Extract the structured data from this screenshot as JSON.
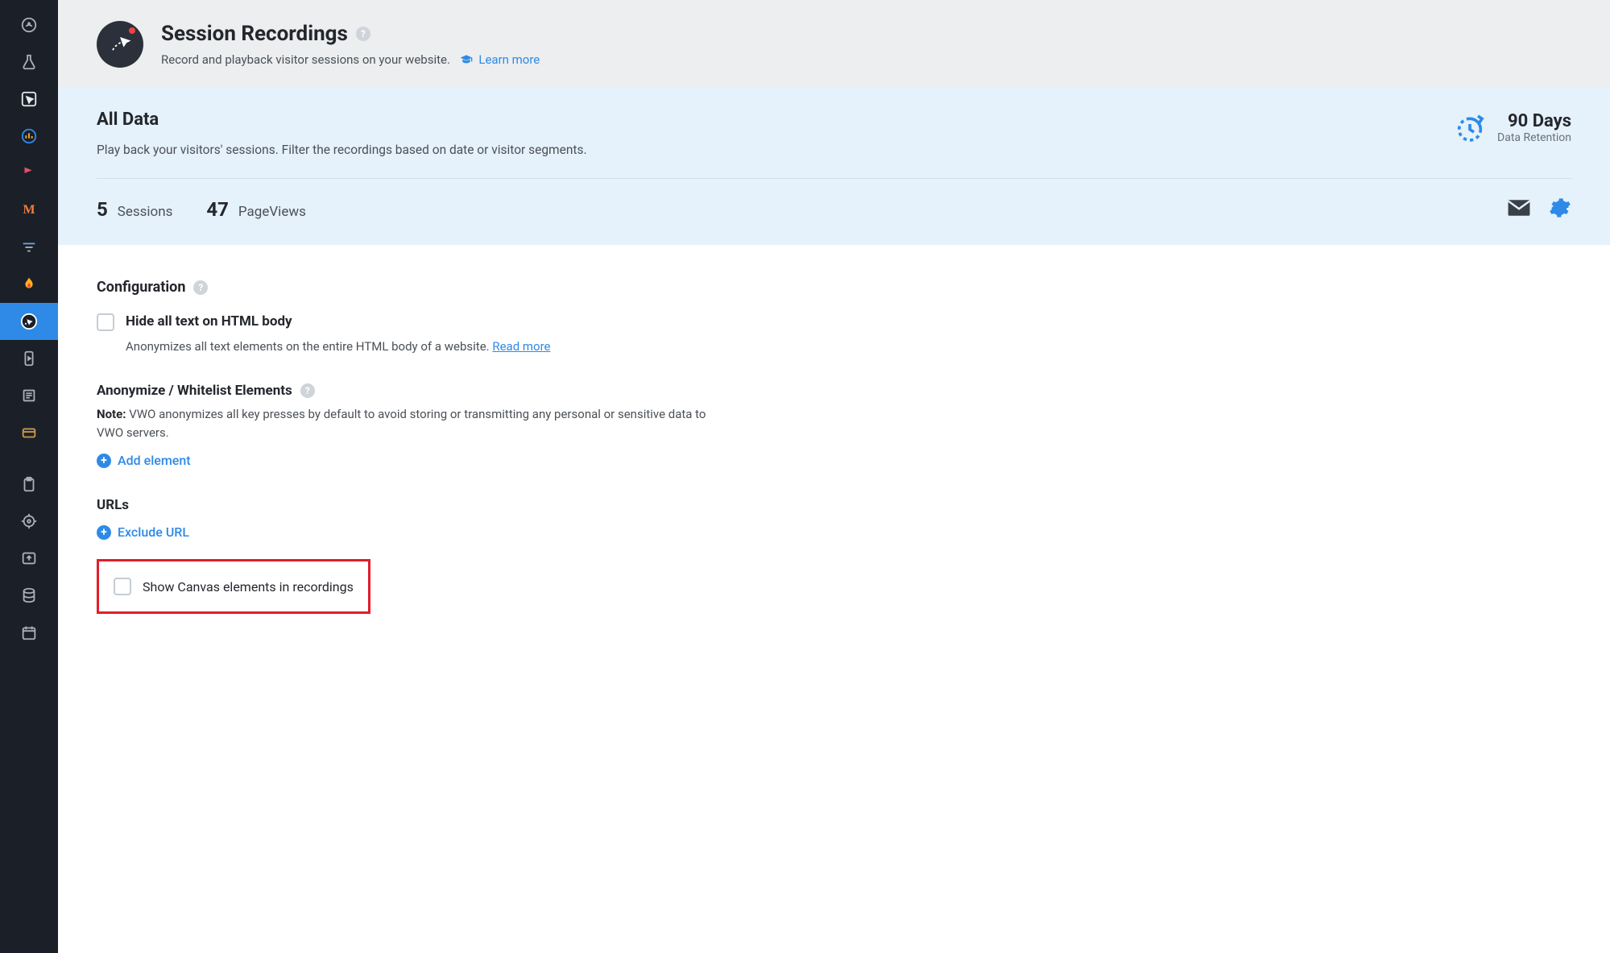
{
  "header": {
    "title": "Session Recordings",
    "subtitle": "Record and playback visitor sessions on your website.",
    "learn_more": "Learn more"
  },
  "panel": {
    "title": "All Data",
    "description": "Play back your visitors' sessions. Filter the recordings based on date or visitor segments.",
    "retention_value": "90 Days",
    "retention_label": "Data Retention",
    "sessions_count": "5",
    "sessions_label": "Sessions",
    "pageviews_count": "47",
    "pageviews_label": "PageViews"
  },
  "config": {
    "section_title": "Configuration",
    "hide_text_label": "Hide all text on HTML body",
    "hide_text_hint": "Anonymizes all text elements on the entire HTML body of a website.",
    "read_more": "Read more",
    "anon_title": "Anonymize / Whitelist Elements",
    "note_prefix": "Note:",
    "note_body": " VWO anonymizes all key presses by default to avoid storing or transmitting any personal or sensitive data to VWO servers.",
    "add_element": "Add element",
    "urls_title": "URLs",
    "exclude_url": "Exclude URL",
    "show_canvas": "Show Canvas elements in recordings"
  }
}
